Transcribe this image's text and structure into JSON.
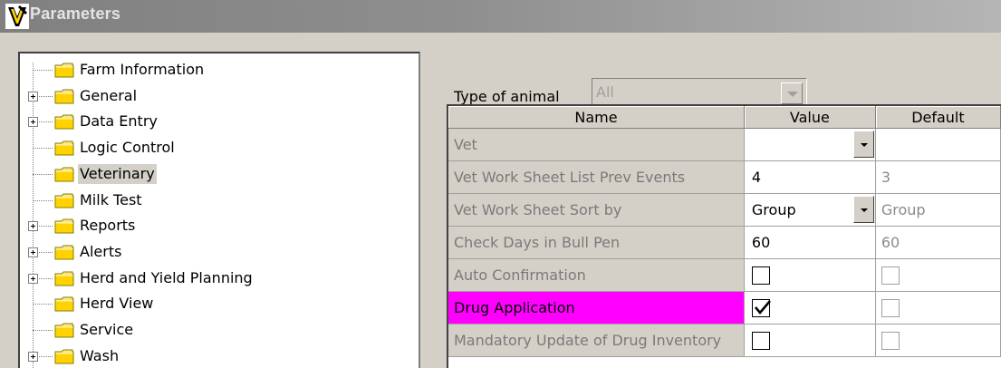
{
  "window": {
    "title": "Parameters",
    "icon": "parameters-app-icon"
  },
  "tree": {
    "items": [
      {
        "label": "Farm Information",
        "expandable": false,
        "selected": false
      },
      {
        "label": "General",
        "expandable": true,
        "selected": false
      },
      {
        "label": "Data Entry",
        "expandable": true,
        "selected": false
      },
      {
        "label": "Logic Control",
        "expandable": false,
        "selected": false
      },
      {
        "label": "Veterinary",
        "expandable": false,
        "selected": true
      },
      {
        "label": "Milk Test",
        "expandable": false,
        "selected": false
      },
      {
        "label": "Reports",
        "expandable": true,
        "selected": false
      },
      {
        "label": "Alerts",
        "expandable": true,
        "selected": false
      },
      {
        "label": "Herd and Yield Planning",
        "expandable": true,
        "selected": false
      },
      {
        "label": "Herd View",
        "expandable": false,
        "selected": false
      },
      {
        "label": "Service",
        "expandable": false,
        "selected": false
      },
      {
        "label": "Wash",
        "expandable": true,
        "selected": false
      }
    ]
  },
  "filter": {
    "label": "Type of animal",
    "value": "All"
  },
  "grid": {
    "headers": [
      "Name",
      "Value",
      "Default"
    ],
    "rows": [
      {
        "name": "Vet",
        "value": "",
        "default": "",
        "value_dropdown": true
      },
      {
        "name": "Vet Work Sheet List Prev Events",
        "value": "4",
        "default": "3"
      },
      {
        "name": "Vet Work Sheet Sort by",
        "value": "Group",
        "default": "Group",
        "value_dropdown": true
      },
      {
        "name": "Check Days in Bull Pen",
        "value": "60",
        "default": "60"
      },
      {
        "name": "Auto Confirmation",
        "checkbox": true,
        "value_checked": false,
        "default_checked": false
      },
      {
        "name": "Drug Application",
        "checkbox": true,
        "value_checked": true,
        "default_checked": false,
        "highlight": true
      },
      {
        "name": "Mandatory Update of Drug Inventory",
        "checkbox": true,
        "value_checked": false,
        "default_checked": false
      }
    ]
  },
  "colors": {
    "highlight": "#ff00ff",
    "panel": "#d4d0c8"
  }
}
